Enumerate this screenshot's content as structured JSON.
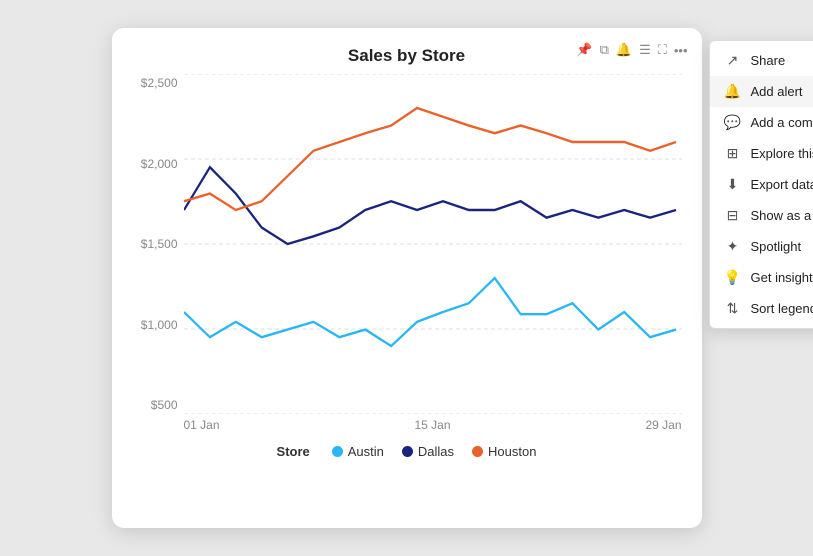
{
  "chart": {
    "title": "Sales by Store",
    "y_labels": [
      "$500",
      "$1,000",
      "$1,500",
      "$2,000",
      "$2,500"
    ],
    "x_labels": [
      "01 Jan",
      "15 Jan",
      "29 Jan"
    ],
    "legend": {
      "store_label": "Store",
      "items": [
        {
          "name": "Austin",
          "color": "#29B6F6"
        },
        {
          "name": "Dallas",
          "color": "#1A237E"
        },
        {
          "name": "Houston",
          "color": "#E8622A"
        }
      ]
    }
  },
  "toolbar": {
    "icons": [
      "pin",
      "copy",
      "bell",
      "filter",
      "expand",
      "more"
    ]
  },
  "context_menu": {
    "items": [
      {
        "label": "Share",
        "icon": "share",
        "has_arrow": true
      },
      {
        "label": "Add alert",
        "icon": "alert",
        "has_arrow": false
      },
      {
        "label": "Add a comment",
        "icon": "comment",
        "has_arrow": false
      },
      {
        "label": "Explore this data (preview)",
        "icon": "explore",
        "has_arrow": false
      },
      {
        "label": "Export data",
        "icon": "export",
        "has_arrow": false
      },
      {
        "label": "Show as a table",
        "icon": "table",
        "has_arrow": false
      },
      {
        "label": "Spotlight",
        "icon": "spotlight",
        "has_arrow": false
      },
      {
        "label": "Get insights",
        "icon": "insights",
        "has_arrow": false
      },
      {
        "label": "Sort legend",
        "icon": "sort",
        "has_arrow": true
      }
    ]
  }
}
